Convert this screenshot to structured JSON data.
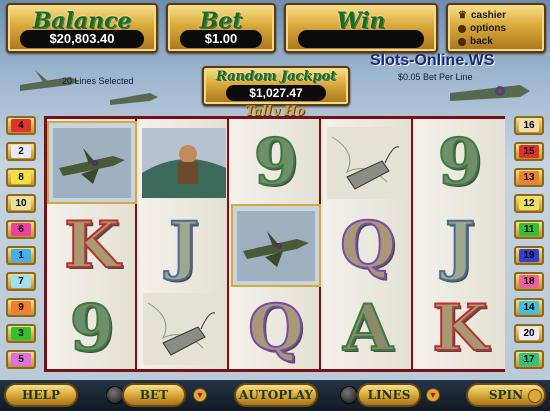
{
  "header": {
    "balance": {
      "label": "Balance",
      "value": "$20,803.40"
    },
    "bet": {
      "label": "Bet",
      "value": "$1.00"
    },
    "win": {
      "label": "Win",
      "value": ""
    },
    "menu": [
      {
        "label": "cashier",
        "icon": "trophy-icon"
      },
      {
        "label": "options",
        "icon": "dot-icon"
      },
      {
        "label": "back",
        "icon": "dot-icon"
      }
    ]
  },
  "site_logo": "Slots-Online.WS",
  "lines_selected": "20 Lines Selected",
  "bet_per_line": "$0.05 Bet Per Line",
  "jackpot": {
    "label": "Random Jackpot",
    "value": "$1,027.47"
  },
  "game_logo": "Tally Ho",
  "reels": [
    [
      "spitfire",
      "K",
      "9"
    ],
    [
      "pilot",
      "J",
      "map-tag"
    ],
    [
      "9",
      "spitfire",
      "Q"
    ],
    [
      "map-tag",
      "Q",
      "A"
    ],
    [
      "9",
      "J",
      "K"
    ]
  ],
  "highlighted": [
    [
      0,
      0
    ],
    [
      2,
      1
    ]
  ],
  "lines_left": [
    {
      "n": "4",
      "color": "#e53030"
    },
    {
      "n": "2",
      "color": "#e8e8ff"
    },
    {
      "n": "8",
      "color": "#f0e040"
    },
    {
      "n": "10",
      "color": "#e8e0a0"
    },
    {
      "n": "6",
      "color": "#f040a0"
    },
    {
      "n": "1",
      "color": "#40b0f0"
    },
    {
      "n": "7",
      "color": "#a0e0f0"
    },
    {
      "n": "9",
      "color": "#f08030"
    },
    {
      "n": "3",
      "color": "#30c030"
    },
    {
      "n": "5",
      "color": "#e070e0"
    }
  ],
  "lines_right": [
    {
      "n": "16",
      "color": "#f0e0b0"
    },
    {
      "n": "15",
      "color": "#e03030"
    },
    {
      "n": "13",
      "color": "#f08030"
    },
    {
      "n": "12",
      "color": "#f0e060"
    },
    {
      "n": "11",
      "color": "#30c030"
    },
    {
      "n": "19",
      "color": "#3040d0"
    },
    {
      "n": "18",
      "color": "#f060a0"
    },
    {
      "n": "14",
      "color": "#40c0e0"
    },
    {
      "n": "20",
      "color": "#e8e8ff"
    },
    {
      "n": "17",
      "color": "#30c080"
    }
  ],
  "controls": {
    "help": "HELP",
    "bet": "BET",
    "autoplay": "AUTOPLAY",
    "lines": "LINES",
    "spin": "SPIN"
  }
}
